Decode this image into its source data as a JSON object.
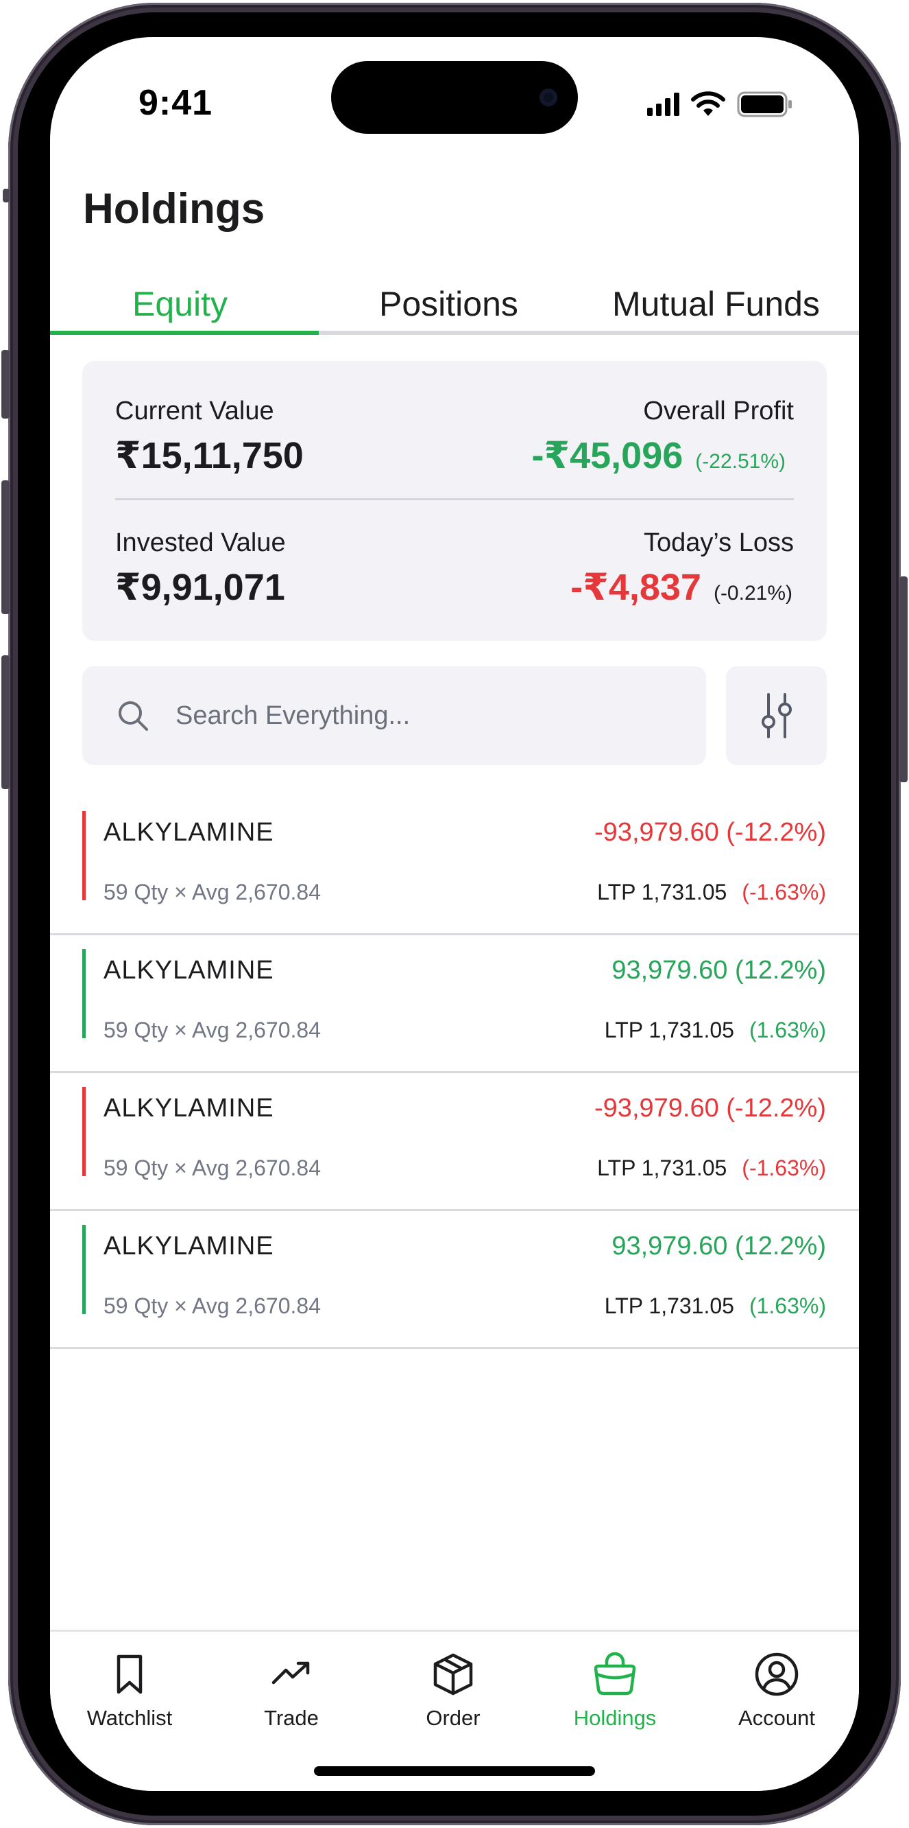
{
  "status_bar": {
    "time": "9:41"
  },
  "header": {
    "title": "Holdings"
  },
  "tabs": [
    {
      "label": "Equity",
      "active": true
    },
    {
      "label": "Positions",
      "active": false
    },
    {
      "label": "Mutual Funds",
      "active": false
    }
  ],
  "summary": {
    "current_value_label": "Current Value",
    "current_value": "₹15,11,750",
    "overall_profit_label": "Overall Profit",
    "overall_profit": "-₹45,096",
    "overall_profit_pct": "(-22.51%)",
    "invested_value_label": "Invested Value",
    "invested_value": "₹9,91,071",
    "todays_loss_label": "Today’s Loss",
    "todays_loss": "-₹4,837",
    "todays_loss_pct": "(-0.21%)"
  },
  "search": {
    "placeholder": "Search Everything...",
    "value": ""
  },
  "holdings": [
    {
      "name": "ALKYLAMINE",
      "qty_avg": "59 Qty × Avg 2,670.84",
      "pnl": "-93,979.60 (-12.2%)",
      "ltp": "LTP 1,731.05",
      "change": "(-1.63%)",
      "trend": "down"
    },
    {
      "name": "ALKYLAMINE",
      "qty_avg": "59 Qty × Avg 2,670.84",
      "pnl": "93,979.60 (12.2%)",
      "ltp": "LTP 1,731.05",
      "change": "(1.63%)",
      "trend": "up"
    },
    {
      "name": "ALKYLAMINE",
      "qty_avg": "59 Qty × Avg 2,670.84",
      "pnl": "-93,979.60 (-12.2%)",
      "ltp": "LTP 1,731.05",
      "change": "(-1.63%)",
      "trend": "down"
    },
    {
      "name": "ALKYLAMINE",
      "qty_avg": "59 Qty × Avg 2,670.84",
      "pnl": "93,979.60 (12.2%)",
      "ltp": "LTP 1,731.05",
      "change": "(1.63%)",
      "trend": "up"
    }
  ],
  "bottom_nav": [
    {
      "label": "Watchlist",
      "icon": "bookmark-icon",
      "active": false
    },
    {
      "label": "Trade",
      "icon": "trending-up-icon",
      "active": false
    },
    {
      "label": "Order",
      "icon": "box-icon",
      "active": false
    },
    {
      "label": "Holdings",
      "icon": "bag-icon",
      "active": true
    },
    {
      "label": "Account",
      "icon": "user-circle-icon",
      "active": false
    }
  ],
  "colors": {
    "accent": "#22b24c",
    "profit": "#27a55a",
    "loss": "#e5383b"
  }
}
